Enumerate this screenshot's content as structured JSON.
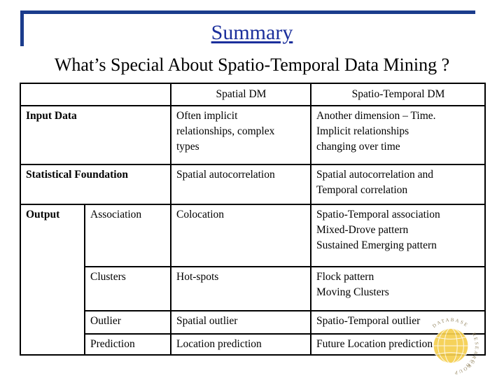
{
  "slide": {
    "title": "Summary",
    "subtitle": "What’s Special About Spatio-Temporal Data Mining ?",
    "accent_blue": "#1b3c8c",
    "title_blue": "#1b2f9c",
    "border_black": "#000000",
    "watermark_gold": "#f3c63a"
  },
  "watermark": {
    "name": "database-research-group-globe-logo",
    "text_top": "DATABASE",
    "text_right": "RESEARCH",
    "text_bottom": "GROUP"
  },
  "table": {
    "header": {
      "label_col": "",
      "sub_col": "",
      "spatial": "Spatial DM",
      "spatio_temporal": "Spatio-Temporal DM"
    },
    "rows": [
      {
        "label": "Input Data",
        "sub": "",
        "spatial": [
          "Often implicit",
          "relationships, complex",
          "types"
        ],
        "spatio_temporal": [
          "Another dimension – Time.",
          "Implicit relationships",
          "changing over time"
        ]
      },
      {
        "label": "Statistical Foundation",
        "sub": "",
        "spatial": [
          "Spatial autocorrelation"
        ],
        "spatio_temporal": [
          "Spatial autocorrelation and",
          "Temporal correlation"
        ]
      },
      {
        "label": "Output",
        "sub": "Association",
        "spatial": [
          "Colocation"
        ],
        "spatio_temporal": [
          "Spatio-Temporal association",
          "Mixed-Drove pattern",
          "Sustained Emerging pattern"
        ]
      },
      {
        "label": "",
        "sub": "Clusters",
        "spatial": [
          "Hot-spots"
        ],
        "spatio_temporal": [
          "Flock pattern",
          "Moving Clusters"
        ]
      },
      {
        "label": "",
        "sub": "Outlier",
        "spatial": [
          "Spatial outlier"
        ],
        "spatio_temporal": [
          "Spatio-Temporal outlier"
        ]
      },
      {
        "label": "",
        "sub": "Prediction",
        "spatial": [
          "Location prediction"
        ],
        "spatio_temporal": [
          "Future Location prediction"
        ]
      }
    ]
  }
}
